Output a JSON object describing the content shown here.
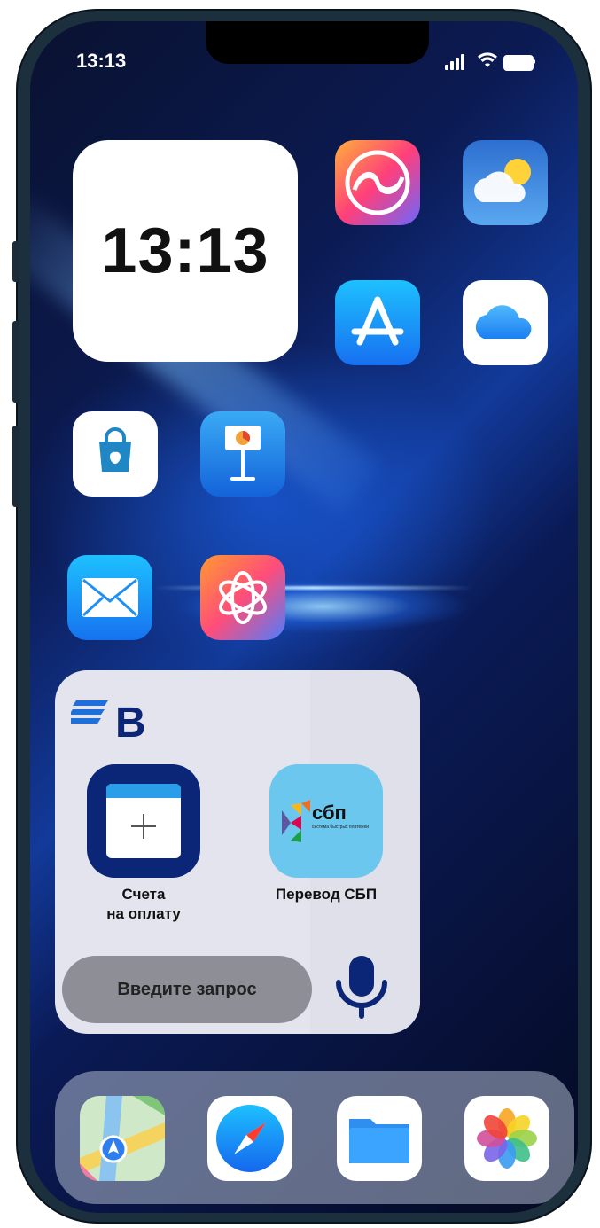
{
  "status_bar": {
    "time": "13:13"
  },
  "clock_widget": {
    "time": "13:13"
  },
  "apps": [
    {
      "name": "Freeform"
    },
    {
      "name": "Weather"
    },
    {
      "name": "App Store"
    },
    {
      "name": "iCloud"
    },
    {
      "name": "Apple Store"
    },
    {
      "name": "Keynote"
    },
    {
      "name": "Mail"
    },
    {
      "name": "Apple Intelligence"
    }
  ],
  "bank_widget": {
    "logo_letter": "B",
    "invoice_label_line1": "Счета",
    "invoice_label_line2": "на оплату",
    "sbp_tile_text": "сбп",
    "sbp_tile_subtext": "система быстрых платежей",
    "sbp_label": "Перевод СБП",
    "search_placeholder": "Введите запрос"
  },
  "dock": [
    {
      "name": "Maps"
    },
    {
      "name": "Safari"
    },
    {
      "name": "Files"
    },
    {
      "name": "Photos"
    }
  ],
  "colors": {
    "bank_blue": "#0b2577",
    "sbp_tile": "#6cc7ee",
    "mic_blue": "#0b2577"
  }
}
